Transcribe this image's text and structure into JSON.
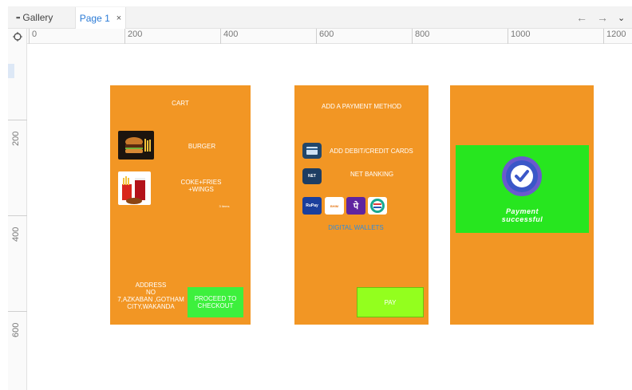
{
  "tabs": {
    "gallery_label": "Gallery",
    "active_page_label": "Page 1",
    "close_glyph": "×"
  },
  "nav": {
    "back_glyph": "←",
    "forward_glyph": "→",
    "more_glyph": "⌄"
  },
  "ruler": {
    "horizontal_labels": [
      "0",
      "200",
      "400",
      "600",
      "800",
      "1000",
      "1200"
    ],
    "vertical_labels": [
      "200",
      "400",
      "600"
    ]
  },
  "cart_screen": {
    "title": "CART",
    "items": [
      {
        "name": "BURGER"
      },
      {
        "name": "COKE+FRIES\n+WINGS"
      }
    ],
    "small_note": "3 items",
    "address": "ADDRESS\nNO\n7,AZKABAN ,GOTHAM\nCITY,WAKANDA",
    "checkout_label": "PROCEED TO\nCHECKOUT"
  },
  "payment_screen": {
    "title": "ADD A PAYMENT METHOD",
    "cards_label": "ADD  DEBIT/CREDIT CARDS",
    "netbanking_label": "NET BANKING",
    "netbanking_icon_text": "NET",
    "wallets_label": "DIGITAL WALLETS",
    "wallet_icons": [
      "RuPay",
      "BHIM",
      "पे",
      "PayZapp"
    ],
    "pay_label": "PAY"
  },
  "success_screen": {
    "message": "Payment\nsuccessful"
  },
  "colors": {
    "screen_bg": "#f29624",
    "checkout_green": "#3df03d",
    "pay_green": "#93ff1e",
    "success_green": "#27e61f",
    "accent_blue": "#2b7bd6"
  }
}
